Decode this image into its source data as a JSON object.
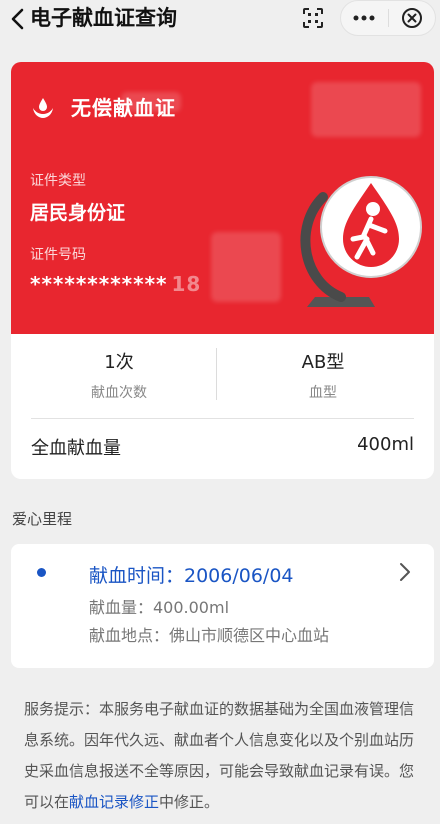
{
  "header": {
    "title": "电子献血证查询",
    "back_icon": "chevron-left-icon",
    "scan_icon": "scan-icon",
    "more_icon": "more-dots-icon",
    "close_icon": "close-circle-icon"
  },
  "card": {
    "title": "无偿献血证",
    "id_type_label": "证件类型",
    "id_type_value": "居民身份证",
    "id_number_label": "证件号码",
    "id_number_value": "************",
    "id_number_suffix": "18",
    "color": "#e8262f"
  },
  "stats": {
    "count_value": "1次",
    "count_label": "献血次数",
    "blood_type_value": "AB型",
    "blood_type_label": "血型",
    "whole_blood_label": "全血献血量",
    "whole_blood_value": "400ml"
  },
  "section": {
    "title": "爱心里程"
  },
  "record": {
    "time": "献血时间：2006/06/04",
    "amount": "献血量：400.00ml",
    "location": "献血地点：佛山市顺德区中心血站"
  },
  "notice": {
    "text_before": "服务提示：本服务电子献血证的数据基础为全国血液管理信息系统。因年代久远、献血者个人信息变化以及个别血站历史采血信息报送不全等原因，可能会导致献血记录有误。您可以在",
    "link": "献血记录修正",
    "text_after": "中修正。"
  },
  "colors": {
    "accent": "#1a55c4",
    "card_red": "#e8262f"
  }
}
